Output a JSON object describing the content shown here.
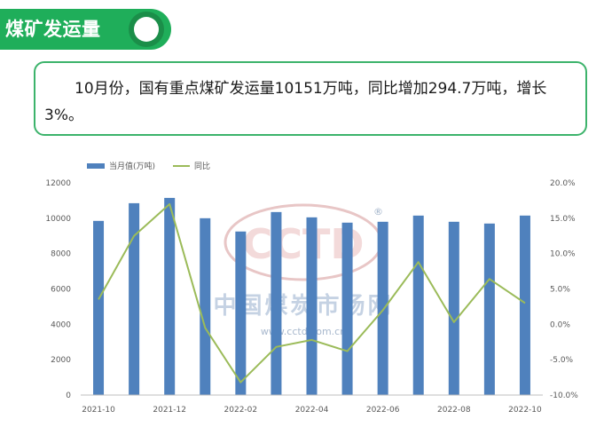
{
  "header": {
    "title": "煤矿发运量"
  },
  "summary": {
    "text": "10月份，国有重点煤矿发运量10151万吨，同比增加294.7万吨，增长3%。"
  },
  "watermark": {
    "logo": "CCTD",
    "registered": "®",
    "name_cn": "中国煤炭市场网",
    "url": "www.cctd.com.cn"
  },
  "colors": {
    "bar": "#4f81bd",
    "line": "#9bbb59",
    "accent_green": "#1fae5a"
  },
  "chart_data": {
    "type": "bar",
    "categories": [
      "2021-10",
      "2021-11",
      "2021-12",
      "2022-01",
      "2022-02",
      "2022-03",
      "2022-04",
      "2022-05",
      "2022-06",
      "2022-07",
      "2022-08",
      "2022-09",
      "2022-10"
    ],
    "x_tick_labels": [
      "2021-10",
      "",
      "2021-12",
      "",
      "2022-02",
      "",
      "2022-04",
      "",
      "2022-06",
      "",
      "2022-08",
      "",
      "2022-10"
    ],
    "series": [
      {
        "name": "当月值(万吨)",
        "kind": "bar",
        "axis": "left",
        "values": [
          9850,
          10850,
          11150,
          10000,
          9250,
          10350,
          10050,
          9750,
          9800,
          10150,
          9800,
          9700,
          10151
        ]
      },
      {
        "name": "同比",
        "kind": "line",
        "axis": "right",
        "values": [
          3.5,
          12.5,
          17.0,
          -0.5,
          -8.2,
          -3.2,
          -2.2,
          -3.8,
          2.0,
          8.8,
          0.3,
          6.4,
          3.0
        ]
      }
    ],
    "ylim": [
      0,
      12000
    ],
    "yticks": [
      0,
      2000,
      4000,
      6000,
      8000,
      10000,
      12000
    ],
    "y2lim": [
      -10,
      20
    ],
    "y2ticks": [
      "-10.0%",
      "-5.0%",
      "0.0%",
      "5.0%",
      "10.0%",
      "15.0%",
      "20.0%"
    ],
    "legend": "top-left",
    "grid": false
  }
}
